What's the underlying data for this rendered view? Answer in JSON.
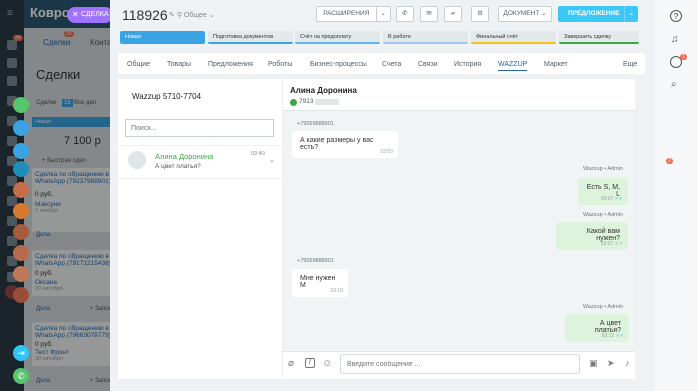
{
  "bg_app": {
    "title": "Ковро",
    "tab_deals": "Сделки",
    "tab_contacts": "Конта",
    "page_title": "Сделки",
    "filter_text": "Сделки",
    "filter_count": "16",
    "filter_all": "Все дел",
    "stage_new": "Новая",
    "sum": "7 100 р",
    "quick_deal": "+ Быстрая сдел",
    "cards": [
      {
        "title": "Сделка по обращению в WhatsApp (79237988901)",
        "price": "0 руб.",
        "person": "Максуня",
        "date": "7 ноября",
        "act": "Дела"
      },
      {
        "title": "Сделка по обращению в WhatsApp (79171215436)",
        "price": "0 руб.",
        "person": "Оксана",
        "date": "30 октября",
        "act": "Дела"
      },
      {
        "title": "Сделка по обращению в WhatsApp (79683078779)",
        "price": "0 руб.",
        "person": "Тест Фронт",
        "date": "30 октября",
        "act": "Дела"
      }
    ],
    "zapos": "+ Запол"
  },
  "deal_pill": "СДЕЛКА",
  "nav_badges": [
    "34",
    "3",
    "25"
  ],
  "header": {
    "deal_number": "118926",
    "category": "Общее",
    "btn_extensions": "РАСШИРЕНИЯ",
    "btn_document": "ДОКУМЕНТ",
    "btn_propose": "ПРЕДЛОЖЕНИЕ"
  },
  "stages": [
    "Новая",
    "Подготовка документов",
    "Счёт на предоплату",
    "В работе",
    "Финальный счёт",
    "Завершить сделку"
  ],
  "tabs": [
    "Общие",
    "Товары",
    "Предложения",
    "Роботы",
    "Бизнес-процессы",
    "Счета",
    "Связи",
    "История",
    "WAZZUP",
    "Маркет",
    "Еще"
  ],
  "wazzup": {
    "channel": "Wazzup 5710-7704",
    "search_placeholder": "Поиск...",
    "contact": {
      "name": "Алина Доронина",
      "time": "03:40",
      "last_message": "А цвет платья?"
    }
  },
  "chat": {
    "name": "Алина Доронина",
    "phone": "7913",
    "messages": [
      {
        "dir": "in",
        "sender": "+79059888901",
        "text": "А какие размеры у вас есть?",
        "time": "03:03"
      },
      {
        "dir": "out",
        "sender": "Wazzup • Admin",
        "text": "Есть S, M, L",
        "time": "03:07"
      },
      {
        "dir": "out",
        "sender": "Wazzup • Admin",
        "text": "Какой вам нужен?",
        "time": "03:07"
      },
      {
        "dir": "in",
        "sender": "+79059888901",
        "text": "Мне нужен М",
        "time": "03:10"
      },
      {
        "dir": "out",
        "sender": "Wazzup • Admin",
        "text": "А цвет платья?",
        "time": "03:12"
      }
    ],
    "input_placeholder": "Введите сообщение ..."
  },
  "right_badges": [
    "1",
    "2"
  ],
  "colors": {
    "accent": "#3bc8f5",
    "stage_active": "#3aa3e3",
    "tab_active": "#2066b0",
    "green": "#56c66c",
    "contact_name": "#3fa647"
  }
}
